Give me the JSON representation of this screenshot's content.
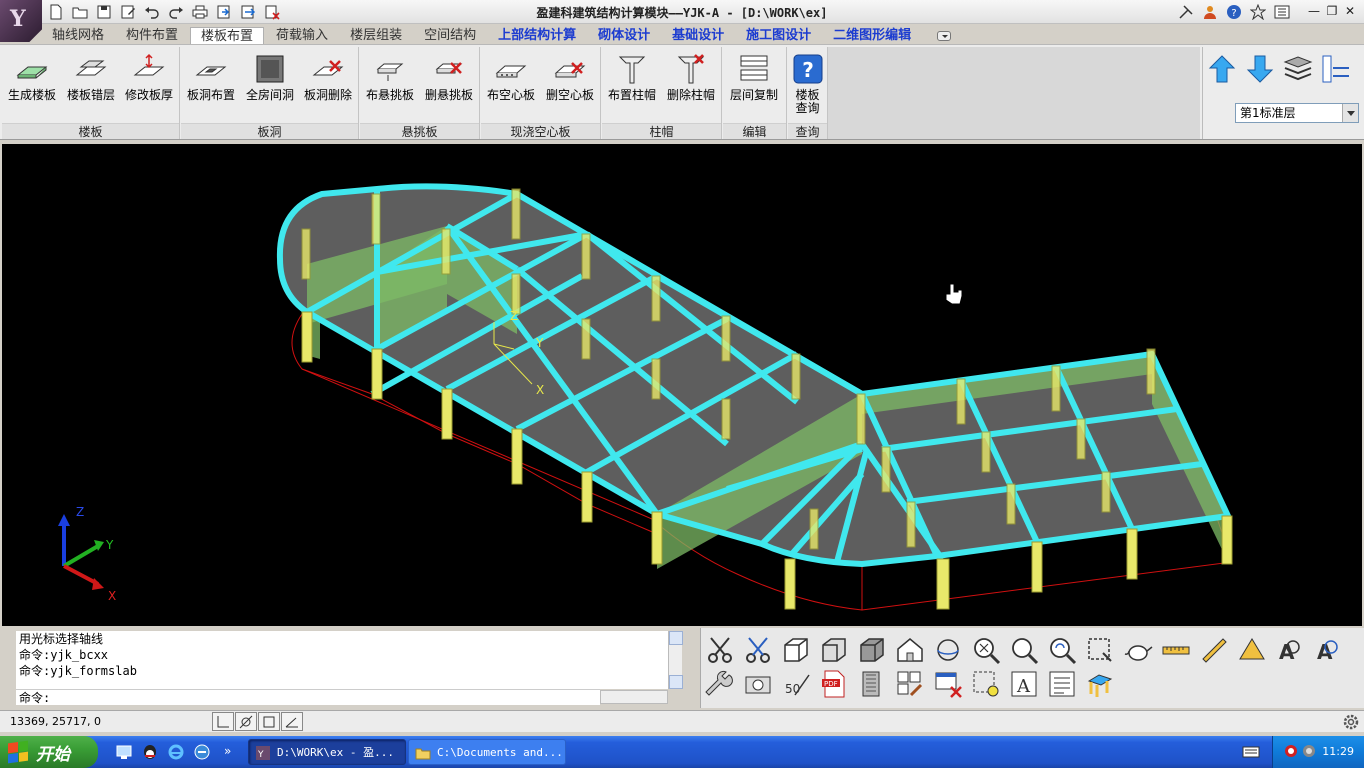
{
  "window": {
    "title": "盈建科建筑结构计算模块——YJK-A - [D:\\WORK\\ex]",
    "logo_text": "Y"
  },
  "quick_access": [
    "new-file-icon",
    "open-folder-icon",
    "save-icon",
    "save-as-icon",
    "undo-icon",
    "redo-icon",
    "print-icon",
    "import-icon",
    "export-icon",
    "close-file-icon"
  ],
  "ribbon_tabs": [
    {
      "label": "轴线网格",
      "style": "normal"
    },
    {
      "label": "构件布置",
      "style": "normal"
    },
    {
      "label": "楼板布置",
      "style": "active"
    },
    {
      "label": "荷载输入",
      "style": "normal"
    },
    {
      "label": "楼层组装",
      "style": "normal"
    },
    {
      "label": "空间结构",
      "style": "normal"
    },
    {
      "label": "上部结构计算",
      "style": "blue"
    },
    {
      "label": "砌体设计",
      "style": "blue"
    },
    {
      "label": "基础设计",
      "style": "blue"
    },
    {
      "label": "施工图设计",
      "style": "blue"
    },
    {
      "label": "二维图形编辑",
      "style": "blue"
    }
  ],
  "ribbon_groups": [
    {
      "name": "楼板",
      "buttons": [
        "生成楼板",
        "楼板错层",
        "修改板厚"
      ]
    },
    {
      "name": "板洞",
      "buttons": [
        "板洞布置",
        "全房间洞",
        "板洞删除"
      ]
    },
    {
      "name": "悬挑板",
      "buttons": [
        "布悬挑板",
        "删悬挑板"
      ]
    },
    {
      "name": "现浇空心板",
      "buttons": [
        "布空心板",
        "删空心板"
      ]
    },
    {
      "name": "柱帽",
      "buttons": [
        "布置柱帽",
        "删除柱帽"
      ]
    },
    {
      "name": "编辑",
      "buttons": [
        "层间复制"
      ]
    },
    {
      "name": "查询",
      "buttons": [
        "楼板\n查询"
      ]
    }
  ],
  "floor_select": {
    "value": "第1标准层"
  },
  "viewport": {
    "axis_labels": {
      "z": "Z",
      "y": "Y",
      "x": "X"
    },
    "colors": {
      "background": "#000000",
      "beam": "#40e8ee",
      "column": "#e8e86a",
      "slab": "#6a6a6a",
      "wall": "#8cc870",
      "axis_red": "#d01010"
    }
  },
  "command": {
    "history": [
      "用光标选择轴线",
      "命令:yjk_bcxx",
      "命令:yjk_formslab"
    ],
    "prompt": "命令:"
  },
  "status": {
    "coords": "13369, 25717, 0"
  },
  "taskbar": {
    "start_label": "开始",
    "tasks": [
      {
        "label": "D:\\WORK\\ex - 盈...",
        "active": true
      },
      {
        "label": "C:\\Documents and...",
        "active": false
      }
    ],
    "clock": "11:29"
  }
}
